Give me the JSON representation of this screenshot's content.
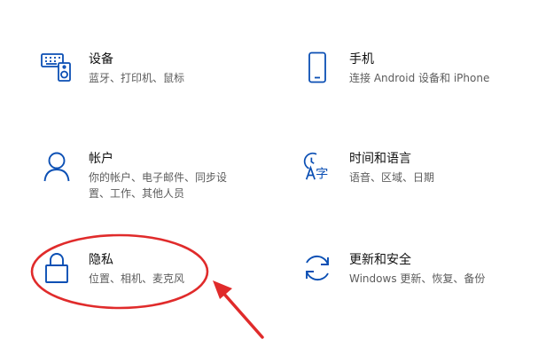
{
  "settings_tiles": {
    "devices": {
      "icon": "devices-keyboard-speaker-icon",
      "title": "设备",
      "desc_lines": [
        "蓝牙、打印机、鼠标"
      ]
    },
    "phone": {
      "icon": "phone-icon",
      "title": "手机",
      "desc_lines": [
        "连接 Android 设备和 iPhone"
      ]
    },
    "accounts": {
      "icon": "person-icon",
      "title": "帐户",
      "desc_lines": [
        "你的帐户、电子邮件、同步设",
        "置、工作、其他人员"
      ]
    },
    "time_language": {
      "icon": "time-language-icon",
      "title": "时间和语言",
      "desc_lines": [
        "语音、区域、日期"
      ]
    },
    "privacy": {
      "icon": "lock-icon",
      "title": "隐私",
      "desc_lines": [
        "位置、相机、麦克风"
      ]
    },
    "update_security": {
      "icon": "sync-arrows-icon",
      "title": "更新和安全",
      "desc_lines": [
        "Windows 更新、恢复、备份"
      ]
    }
  },
  "colors": {
    "icon_blue": "#0b4fb4",
    "annotation_red": "#e02b2b",
    "title_text": "#111111",
    "desc_text": "#5c5c5c"
  },
  "annotation": {
    "highlight": "privacy",
    "shape": "ellipse-with-arrow"
  }
}
